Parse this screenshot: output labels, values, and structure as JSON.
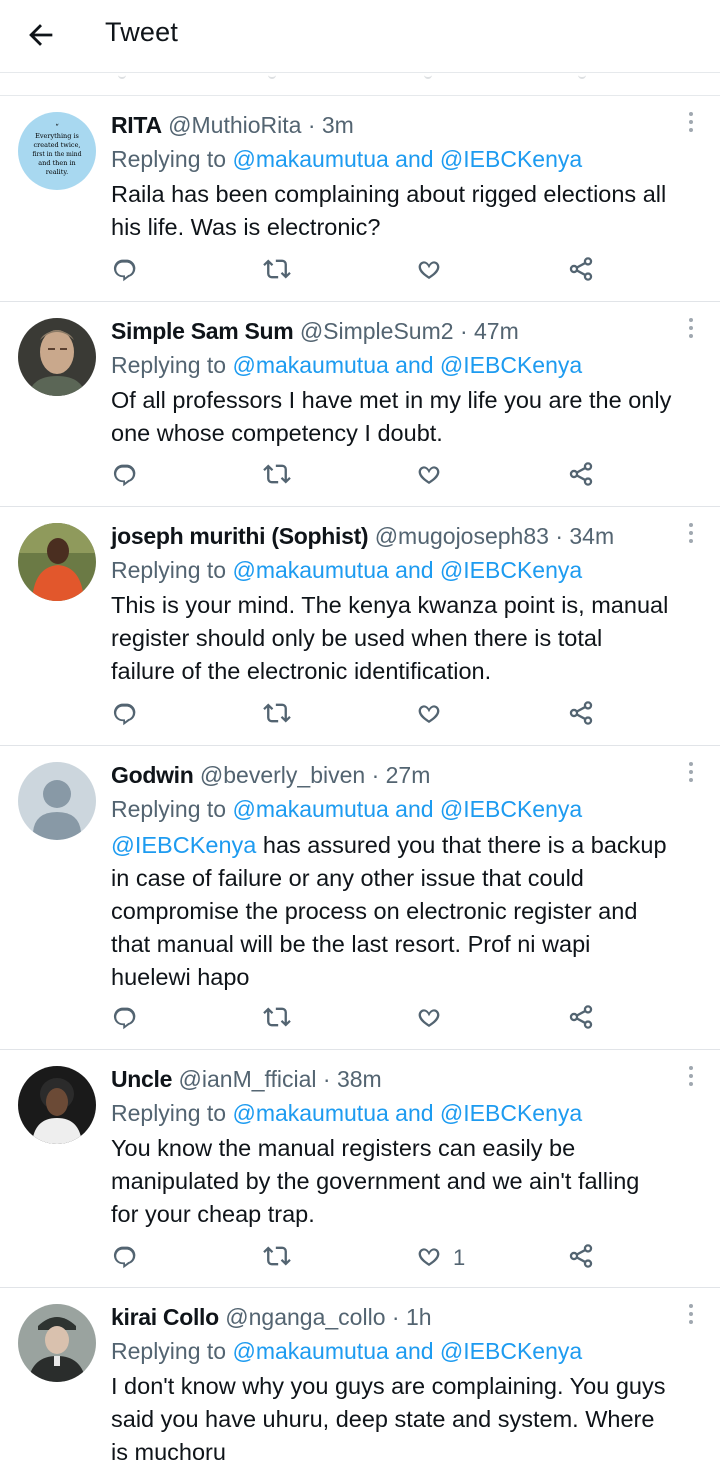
{
  "header": {
    "title": "Tweet"
  },
  "tweets": [
    {
      "name": "RITA",
      "handle": "@MuthioRita",
      "time": "· 3m",
      "reply_prefix": "Replying to",
      "reply_to": "@makaumutua and @IEBCKenya",
      "lines": [
        "Raila has been complaining about rigged elections all",
        "his life. Was is electronic?"
      ],
      "likes": "",
      "avatar_text": [
        "“",
        "Everything is",
        "created twice,",
        "first in the mind",
        "and then in",
        "reality."
      ]
    },
    {
      "name": "Simple Sam Sum",
      "handle": "@SimpleSum2",
      "time": "· 47m",
      "reply_prefix": "Replying to",
      "reply_to": "@makaumutua and @IEBCKenya",
      "lines": [
        "Of all professors I have met in my life you are the only",
        "one whose competency I doubt."
      ],
      "likes": ""
    },
    {
      "name": "joseph murithi (Sophist)",
      "handle": "@mugojoseph83",
      "time": "· 34m",
      "reply_prefix": "Replying to",
      "reply_to": "@makaumutua and @IEBCKenya",
      "lines": [
        "This is your mind. The kenya kwanza point is, manual",
        "register should only be used when there is total",
        "failure of the electronic identification."
      ],
      "likes": ""
    },
    {
      "name": "Godwin",
      "handle": "@beverly_biven",
      "time": "· 27m",
      "reply_prefix": "Replying to",
      "reply_to": "@makaumutua and @IEBCKenya",
      "mention": "@IEBCKenya",
      "first_line_rest": " has assured you that there is a backup",
      "lines": [
        "in case of failure or any other issue that could",
        "compromise the process on electronic register and",
        "that manual will be the last resort. Prof ni wapi",
        "huelewi hapo"
      ],
      "likes": ""
    },
    {
      "name": "Uncle",
      "handle": "@ianM_fficial",
      "time": "· 38m",
      "reply_prefix": "Replying to",
      "reply_to": "@makaumutua and @IEBCKenya",
      "lines": [
        "You know the manual registers can easily be",
        "manipulated by the government and we ain't falling",
        "for your cheap trap."
      ],
      "likes": "1"
    },
    {
      "name": "kirai Collo",
      "handle": "@nganga_collo",
      "time": "· 1h",
      "reply_prefix": "Replying to",
      "reply_to": "@makaumutua and @IEBCKenya",
      "lines": [
        "I don't know why you guys are complaining. You guys",
        "said you have uhuru, deep state and system. Where",
        "is muchoru"
      ],
      "likes": ""
    }
  ],
  "colors": {
    "link": "#1d9bf0",
    "meta": "#536471",
    "divider": "#e1e4e8"
  },
  "icons": [
    "back-arrow-icon",
    "reply-icon",
    "retweet-icon",
    "like-icon",
    "share-icon",
    "more-icon"
  ]
}
